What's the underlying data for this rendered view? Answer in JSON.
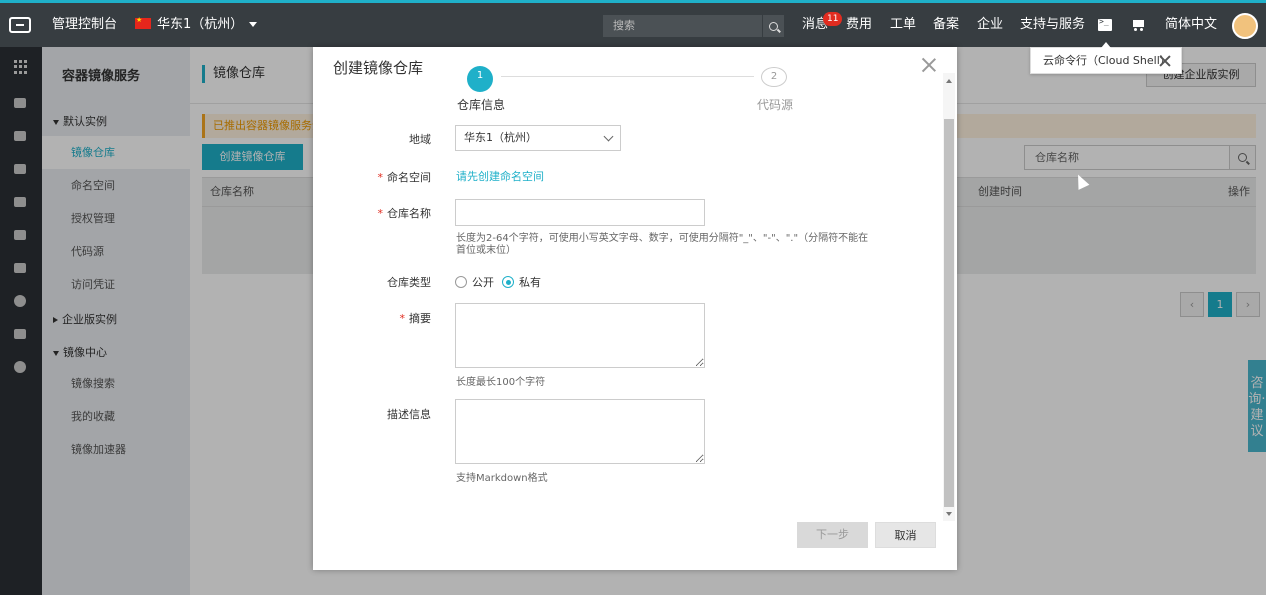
{
  "topbar": {
    "console": "管理控制台",
    "region": "华东1（杭州）",
    "search_placeholder": "搜索",
    "messages": "消息",
    "message_badge": "11",
    "billing": "费用",
    "tickets": "工单",
    "icp": "备案",
    "enterprise": "企业",
    "support": "支持与服务",
    "language": "简体中文"
  },
  "tooltip": {
    "text": "云命令行（Cloud Shell）"
  },
  "subnav": {
    "title": "容器镜像服务",
    "default_instance": "默认实例",
    "items": [
      {
        "label": "镜像仓库"
      },
      {
        "label": "命名空间"
      },
      {
        "label": "授权管理"
      },
      {
        "label": "代码源"
      },
      {
        "label": "访问凭证"
      }
    ],
    "enterprise_instance": "企业版实例",
    "image_center": "镜像中心",
    "center_items": [
      {
        "label": "镜像搜索"
      },
      {
        "label": "我的收藏"
      },
      {
        "label": "镜像加速器"
      }
    ]
  },
  "main": {
    "breadcrumb": "镜像仓库",
    "create_enterprise": "创建企业版实例",
    "notice": "已推出容器镜像服务企",
    "create_repo": "创建镜像仓库",
    "search_placeholder": "仓库名称",
    "columns": {
      "name": "仓库名称",
      "created": "创建时间",
      "actions": "操作"
    },
    "pagination": {
      "prev": "‹",
      "current": "1",
      "next": "›"
    }
  },
  "feedback": {
    "label": "咨询·建议"
  },
  "dialog": {
    "title": "创建镜像仓库",
    "steps": [
      {
        "num": "1",
        "label": "仓库信息"
      },
      {
        "num": "2",
        "label": "代码源"
      }
    ],
    "region_label": "地域",
    "region_value": "华东1（杭州）",
    "namespace_label": "命名空间",
    "namespace_link": "请先创建命名空间",
    "repo_name_label": "仓库名称",
    "repo_name_hint": "长度为2-64个字符，可使用小写英文字母、数字，可使用分隔符\"_\"、\"-\"、\".\"（分隔符不能在首位或末位）",
    "repo_type_label": "仓库类型",
    "type_public": "公开",
    "type_private": "私有",
    "summary_label": "摘要",
    "summary_hint": "长度最长100个字符",
    "desc_label": "描述信息",
    "desc_hint": "支持Markdown格式",
    "next_btn": "下一步",
    "cancel_btn": "取消"
  },
  "colors": {
    "accent": "#1fb0c9",
    "topbar_bg": "#373d41",
    "rail_bg": "#2b3035",
    "subnav_bg": "#eaedf1",
    "required": "#e12c20",
    "notice_text": "#f09b00"
  }
}
